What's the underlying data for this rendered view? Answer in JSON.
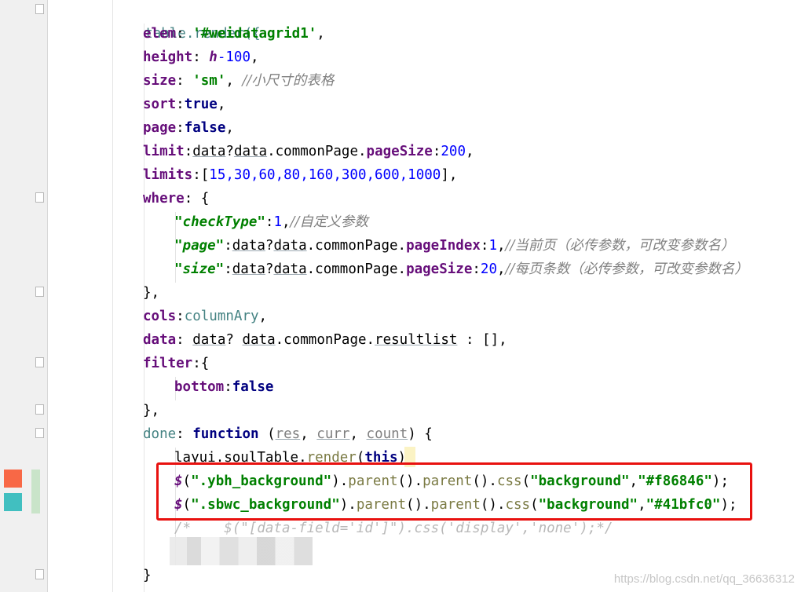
{
  "editor": {
    "swatches": [
      {
        "name": "coral-swatch",
        "color": "#f86846"
      },
      {
        "name": "teal-swatch",
        "color": "#41bfc0"
      }
    ],
    "lines": {
      "l1": "table.render({",
      "elem_key": "elem",
      "elem_val": "'#weidatagrid1'",
      "height_key": "height",
      "height_var": "h",
      "height_num": "-100",
      "size_key": "size",
      "size_val": "'sm'",
      "size_comment": "//小尺寸的表格",
      "sort_key": "sort",
      "sort_val": "true",
      "page_key": "page",
      "page_val": "false",
      "limit_key": "limit",
      "limit_d1": "data",
      "limit_d2": "data",
      "limit_cp": "commonPage",
      "limit_ps": "pageSize",
      "limit_num": "200",
      "limits_key": "limits",
      "limits_vals": "15,30,60,80,160,300,600,1000",
      "where_key": "where",
      "checktype_key": "\"checkType\"",
      "checktype_val": "1",
      "checktype_comment": "//自定义参数",
      "wpage_key": "\"page\"",
      "wpage_d1": "data",
      "wpage_d2": "data",
      "wpage_cp": "commonPage",
      "wpage_pi": "pageIndex",
      "wpage_num": "1",
      "wpage_comment": "//当前页（必传参数，可改变参数名）",
      "wsize_key": "\"size\"",
      "wsize_d1": "data",
      "wsize_d2": "data",
      "wsize_cp": "commonPage",
      "wsize_ps": "pageSize",
      "wsize_num": "20",
      "wsize_comment": "//每页条数（必传参数，可改变参数名）",
      "cols_key": "cols",
      "cols_val": "columnAry",
      "data_key": "data",
      "data_d1": "data",
      "data_d2": "data",
      "data_cp": "commonPage",
      "data_rl": "resultlist",
      "data_tail": " : [],",
      "filter_key": "filter",
      "bottom_key": "bottom",
      "bottom_val": "false",
      "done_key": "done",
      "done_fn": "function",
      "done_p1": "res",
      "done_p2": "curr",
      "done_p3": "count",
      "soul_obj": "layui",
      "soul_mod": "soulTable",
      "soul_fn": "render",
      "soul_arg": "this",
      "ybh_dollar": "$",
      "ybh_sel": "\".ybh_background\"",
      "ybh_parent": "parent",
      "ybh_css": "css",
      "ybh_prop": "\"background\"",
      "ybh_color": "\"#f86846\"",
      "sbwc_dollar": "$",
      "sbwc_sel": "\".sbwc_background\"",
      "sbwc_parent": "parent",
      "sbwc_css": "css",
      "sbwc_prop": "\"background\"",
      "sbwc_color": "\"#41bfc0\"",
      "comment_line": "/*    $(\"[data-field='id']\").css('display','none');*/",
      "close_brace": "}"
    }
  },
  "watermark": "https://blog.csdn.net/qq_36636312"
}
